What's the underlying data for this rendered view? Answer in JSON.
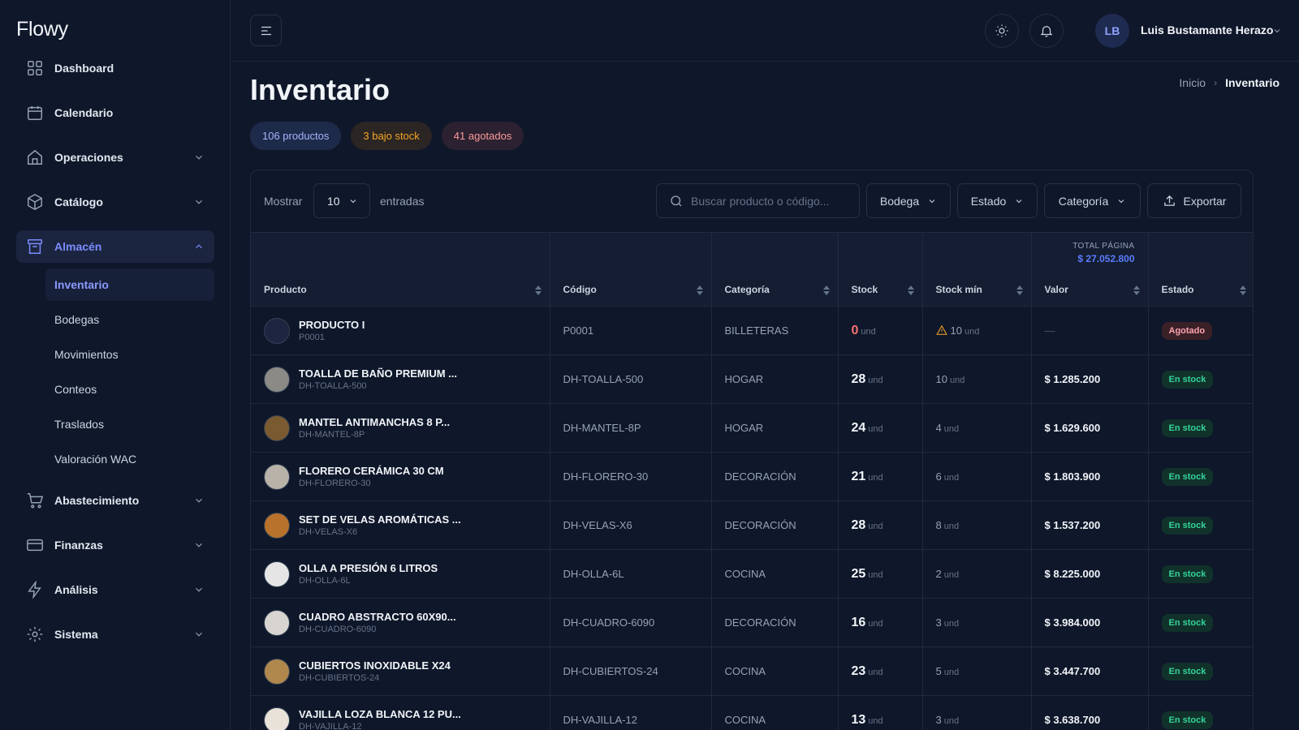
{
  "app": {
    "name": "Flowy"
  },
  "sidebar": {
    "items": [
      {
        "label": "Dashboard",
        "icon": "grid-icon",
        "has_chevron": false
      },
      {
        "label": "Calendario",
        "icon": "calendar-icon",
        "has_chevron": true
      },
      {
        "label": "Operaciones",
        "icon": "home-icon",
        "has_chevron": true
      },
      {
        "label": "Catálogo",
        "icon": "box-icon",
        "has_chevron": true
      },
      {
        "label": "Almacén",
        "icon": "archive-icon",
        "has_chevron": true,
        "expanded": true
      }
    ],
    "sub_items": [
      "Inventario",
      "Bodegas",
      "Movimientos",
      "Conteos",
      "Traslados",
      "Valoración WAC"
    ],
    "active_sub": "Inventario",
    "bottom_items": [
      {
        "label": "Abastecimiento",
        "icon": "cart-icon"
      },
      {
        "label": "Finanzas",
        "icon": "card-icon"
      },
      {
        "label": "Análisis",
        "icon": "bolt-icon"
      },
      {
        "label": "Sistema",
        "icon": "gear-icon"
      }
    ]
  },
  "topbar": {
    "user_initials": "LB",
    "user_name": "Luis Bustamante Herazo"
  },
  "page": {
    "title": "Inventario",
    "breadcrumb": {
      "home": "Inicio",
      "current": "Inventario"
    },
    "badges": {
      "products": "106 productos",
      "low_stock": "3 bajo stock",
      "out_of_stock": "41 agotados"
    }
  },
  "toolbar": {
    "show_label": "Mostrar",
    "entries_value": "10",
    "entries_label": "entradas",
    "search_placeholder": "Buscar producto o código...",
    "filters": [
      "Bodega",
      "Estado",
      "Categoría"
    ],
    "export_label": "Exportar"
  },
  "table": {
    "total_label": "TOTAL PÁGINA",
    "total_value": "$ 27.052.800",
    "columns": [
      "Producto",
      "Código",
      "Categoría",
      "Stock",
      "Stock mín",
      "Valor",
      "Estado"
    ],
    "unit": "und",
    "rows": [
      {
        "name": "PRODUCTO I",
        "sku": "P0001",
        "code": "P0001",
        "category": "BILLETERAS",
        "stock": "0",
        "min": "10",
        "min_warn": true,
        "value": "—",
        "status": "Agotado",
        "status_type": "out",
        "thumb": "#1e2540"
      },
      {
        "name": "TOALLA DE BAÑO PREMIUM ...",
        "sku": "DH-TOALLA-500",
        "code": "DH-TOALLA-500",
        "category": "HOGAR",
        "stock": "28",
        "min": "10",
        "min_warn": false,
        "value": "$ 1.285.200",
        "status": "En stock",
        "status_type": "ok",
        "thumb": "#8c8a86"
      },
      {
        "name": "MANTEL ANTIMANCHAS 8 P...",
        "sku": "DH-MANTEL-8P",
        "code": "DH-MANTEL-8P",
        "category": "HOGAR",
        "stock": "24",
        "min": "4",
        "min_warn": false,
        "value": "$ 1.629.600",
        "status": "En stock",
        "status_type": "ok",
        "thumb": "#7a5a30"
      },
      {
        "name": "FLORERO CERÁMICA 30 CM",
        "sku": "DH-FLORERO-30",
        "code": "DH-FLORERO-30",
        "category": "DECORACIÓN",
        "stock": "21",
        "min": "6",
        "min_warn": false,
        "value": "$ 1.803.900",
        "status": "En stock",
        "status_type": "ok",
        "thumb": "#b8b2a8"
      },
      {
        "name": "SET DE VELAS AROMÁTICAS ...",
        "sku": "DH-VELAS-X6",
        "code": "DH-VELAS-X6",
        "category": "DECORACIÓN",
        "stock": "28",
        "min": "8",
        "min_warn": false,
        "value": "$ 1.537.200",
        "status": "En stock",
        "status_type": "ok",
        "thumb": "#b8722c"
      },
      {
        "name": "OLLA A PRESIÓN 6 LITROS",
        "sku": "DH-OLLA-6L",
        "code": "DH-OLLA-6L",
        "category": "COCINA",
        "stock": "25",
        "min": "2",
        "min_warn": false,
        "value": "$ 8.225.000",
        "status": "En stock",
        "status_type": "ok",
        "thumb": "#e5e5e5"
      },
      {
        "name": "CUADRO ABSTRACTO 60X90...",
        "sku": "DH-CUADRO-6090",
        "code": "DH-CUADRO-6090",
        "category": "DECORACIÓN",
        "stock": "16",
        "min": "3",
        "min_warn": false,
        "value": "$ 3.984.000",
        "status": "En stock",
        "status_type": "ok",
        "thumb": "#d8d4cf"
      },
      {
        "name": "CUBIERTOS INOXIDABLE X24",
        "sku": "DH-CUBIERTOS-24",
        "code": "DH-CUBIERTOS-24",
        "category": "COCINA",
        "stock": "23",
        "min": "5",
        "min_warn": false,
        "value": "$ 3.447.700",
        "status": "En stock",
        "status_type": "ok",
        "thumb": "#b0874d"
      },
      {
        "name": "VAJILLA LOZA BLANCA 12 PU...",
        "sku": "DH-VAJILLA-12",
        "code": "DH-VAJILLA-12",
        "category": "COCINA",
        "stock": "13",
        "min": "3",
        "min_warn": false,
        "value": "$ 3.638.700",
        "status": "En stock",
        "status_type": "ok",
        "thumb": "#e8e2d8"
      }
    ]
  }
}
